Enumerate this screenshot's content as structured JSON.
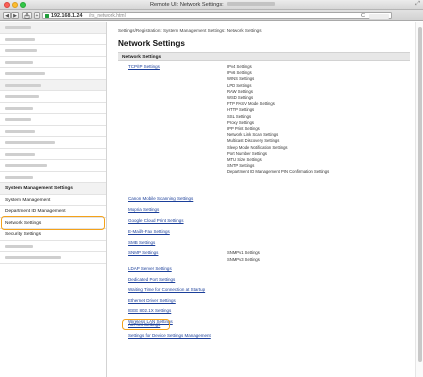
{
  "browser": {
    "window_title": "Remote UI: Network Settings:",
    "url_host": "192.168.1.24",
    "url_path": "/rs_network.html",
    "back_glyph": "◀",
    "forward_glyph": "▶",
    "reload_glyph": "C",
    "icons": {
      "back": "back-arrow-icon",
      "forward": "forward-arrow-icon",
      "share": "share-icon",
      "reload": "reload-icon",
      "favicon": "site-favicon-icon"
    }
  },
  "sidebar": {
    "system_management_heading": "System Management Settings",
    "items": [
      "System Management",
      "Department ID Management",
      "Network Settings",
      "Security Settings"
    ],
    "highlight_color": "#f4a21a"
  },
  "main": {
    "breadcrumb": "Settings/Registration: System Management Settings: Network Settings",
    "title": "Network Settings",
    "section": "Network Settings",
    "tcpip": {
      "label": "TCP/IP Settings",
      "sub_items": [
        "IPv4 Settings",
        "IPv6 Settings",
        "WINS Settings",
        "LPD Settings",
        "RAW Settings",
        "WSD Settings",
        "FTP PASV Mode Settings",
        "HTTP Settings",
        "SSL Settings",
        "Proxy Settings",
        "IPP Print Settings",
        "Network Link Scan Settings",
        "Multicast Discovery Settings",
        "Sleep Mode Notification Settings",
        "Port Number Settings",
        "MTU Size Settings",
        "SNTP Settings",
        "Department ID Management PIN Confirmation Settings"
      ]
    },
    "links_a": [
      "Canon Mobile Scanning Settings",
      "Mopria Settings",
      "Google Cloud Print Settings",
      "E-Mail/I-Fax Settings",
      "SMB Settings"
    ],
    "snmp": {
      "label": "SNMP Settings",
      "sub_items": [
        "SNMPv1 Settings",
        "SNMPv3 Settings"
      ]
    },
    "links_b": [
      "LDAP Server Settings",
      "Dedicated Port Settings",
      "Waiting Time for Connection at Startup",
      "Ethernet Driver Settings",
      "IEEE 802.1X Settings",
      "Wireless LAN Settings",
      "AirPrint Settings",
      "Settings for Device Settings Management"
    ],
    "highlight_color": "#f4a21a"
  }
}
